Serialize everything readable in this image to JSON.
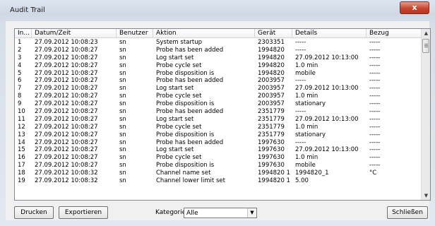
{
  "window": {
    "title": "Audit Trail",
    "close_label": "x"
  },
  "table": {
    "columns": [
      "In...",
      "Datum/Zeit",
      "Benutzer",
      "Aktion",
      "Gerät",
      "Details",
      "Bezug"
    ],
    "rows": [
      [
        "1",
        "27.09.2012 10:08:23",
        "sn",
        "System startup",
        "2303351",
        "-----",
        "-----"
      ],
      [
        "2",
        "27.09.2012 10:08:27",
        "sn",
        "Probe has been added",
        "1994820",
        "-----",
        "-----"
      ],
      [
        "3",
        "27.09.2012 10:08:27",
        "sn",
        "Log start set",
        "1994820",
        "27.09.2012 10:13:00",
        "-----"
      ],
      [
        "4",
        "27.09.2012 10:08:27",
        "sn",
        "Probe cycle set",
        "1994820",
        "1.0 min",
        "-----"
      ],
      [
        "5",
        "27.09.2012 10:08:27",
        "sn",
        "Probe disposition is",
        "1994820",
        "mobile",
        "-----"
      ],
      [
        "6",
        "27.09.2012 10:08:27",
        "sn",
        "Probe has been added",
        "2003957",
        "-----",
        "-----"
      ],
      [
        "7",
        "27.09.2012 10:08:27",
        "sn",
        "Log start set",
        "2003957",
        "27.09.2012 10:13:00",
        "-----"
      ],
      [
        "8",
        "27.09.2012 10:08:27",
        "sn",
        "Probe cycle set",
        "2003957",
        "1.0 min",
        "-----"
      ],
      [
        "9",
        "27.09.2012 10:08:27",
        "sn",
        "Probe disposition is",
        "2003957",
        "stationary",
        "-----"
      ],
      [
        "10",
        "27.09.2012 10:08:27",
        "sn",
        "Probe has been added",
        "2351779",
        "-----",
        "-----"
      ],
      [
        "11",
        "27.09.2012 10:08:27",
        "sn",
        "Log start set",
        "2351779",
        "27.09.2012 10:13:00",
        "-----"
      ],
      [
        "12",
        "27.09.2012 10:08:27",
        "sn",
        "Probe cycle set",
        "2351779",
        "1.0 min",
        "-----"
      ],
      [
        "13",
        "27.09.2012 10:08:27",
        "sn",
        "Probe disposition is",
        "2351779",
        "stationary",
        "-----"
      ],
      [
        "14",
        "27.09.2012 10:08:27",
        "sn",
        "Probe has been added",
        "1997630",
        "-----",
        "-----"
      ],
      [
        "15",
        "27.09.2012 10:08:27",
        "sn",
        "Log start set",
        "1997630",
        "27.09.2012 10:13:00",
        "-----"
      ],
      [
        "16",
        "27.09.2012 10:08:27",
        "sn",
        "Probe cycle set",
        "1997630",
        "1.0 min",
        "-----"
      ],
      [
        "17",
        "27.09.2012 10:08:27",
        "sn",
        "Probe disposition is",
        "1997630",
        "mobile",
        "-----"
      ],
      [
        "18",
        "27.09.2012 10:08:32",
        "sn",
        "Channel name set",
        "1994820 1",
        "1994820_1",
        "°C"
      ],
      [
        "19",
        "27.09.2012 10:08:32",
        "sn",
        "Channel lower limit set",
        "1994820 1",
        "5.00",
        ""
      ]
    ]
  },
  "footer": {
    "print_label": "Drucken",
    "export_label": "Exportieren",
    "category_label": "Kategorie",
    "category_value": "Alle",
    "close_label": "Schließen"
  },
  "icons": {
    "scroll_up": "triangle-up",
    "scroll_down": "triangle-down",
    "dropdown": "triangle-down"
  },
  "colors": {
    "close_button": "#c8452f",
    "window_bg": "#f0f0f0"
  }
}
